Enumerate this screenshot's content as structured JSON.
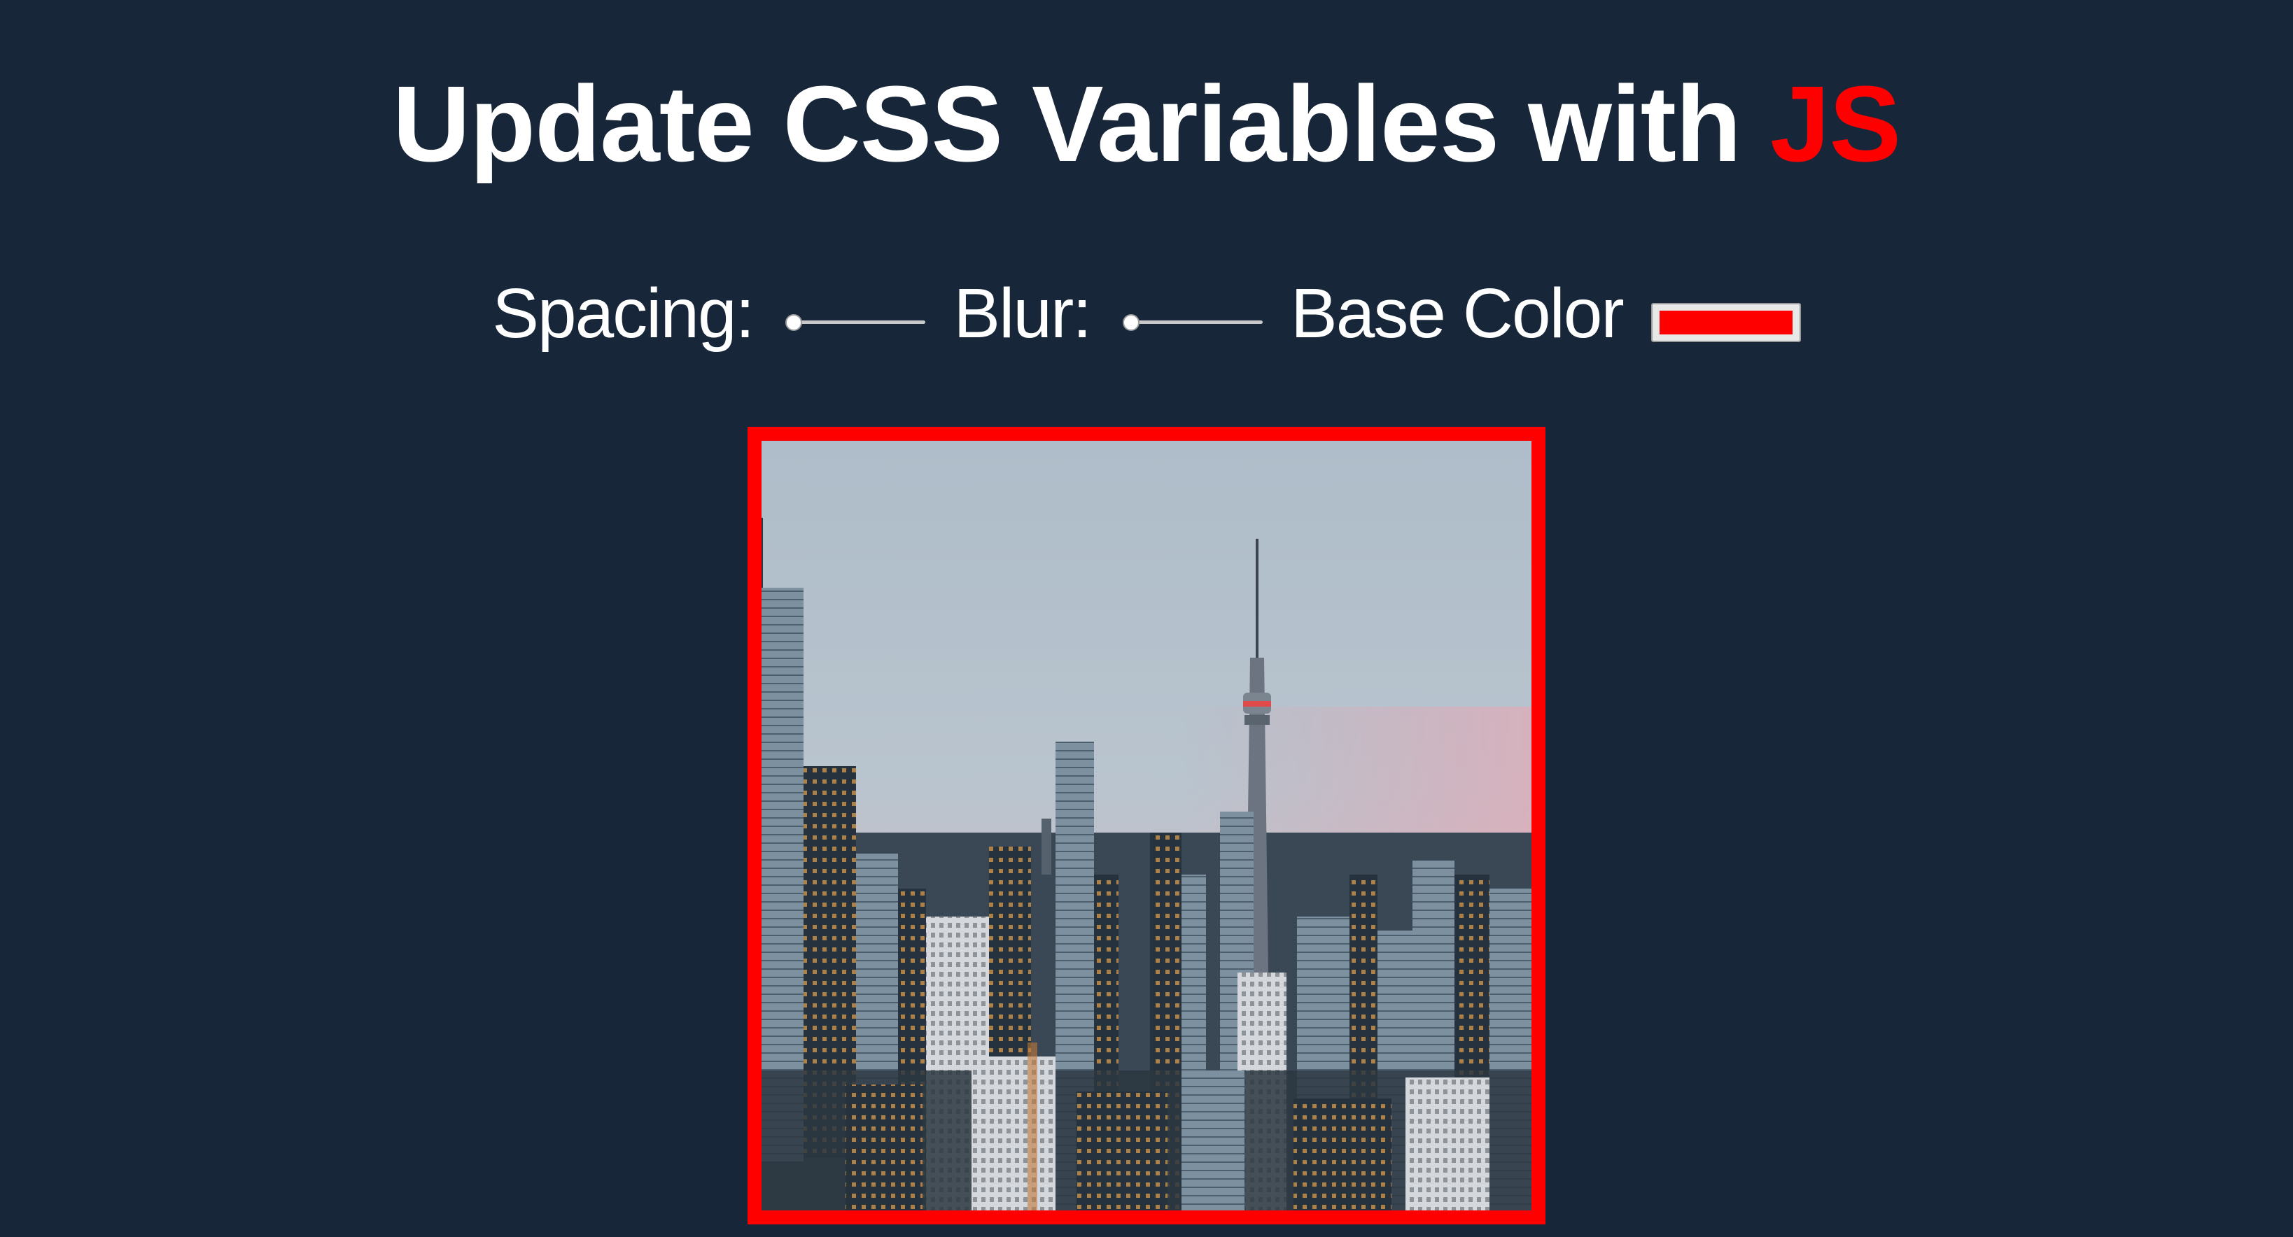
{
  "title": {
    "main": "Update CSS Variables with ",
    "highlight": "JS",
    "highlight_color": "#ff0000"
  },
  "controls": {
    "spacing_label": "Spacing:",
    "blur_label": "Blur:",
    "base_color_label": "Base Color",
    "spacing_value": 0,
    "blur_value": 0,
    "base_color_value": "#ff0000"
  },
  "image": {
    "subject": "city-skyline-photo",
    "border_color": "#ff0000"
  },
  "colors": {
    "background": "#172739",
    "text": "#ffffff",
    "accent": "#ff0000"
  }
}
